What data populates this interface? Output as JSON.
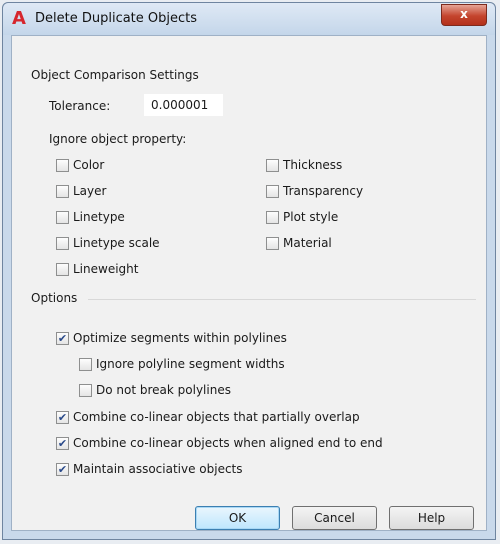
{
  "window": {
    "title": "Delete Duplicate Objects",
    "close_label": "x"
  },
  "comparison": {
    "group_label": "Object Comparison Settings",
    "tolerance_label": "Tolerance:",
    "tolerance_value": "0.000001",
    "ignore_label": "Ignore object property:",
    "properties": [
      {
        "label": "Color",
        "checked": false
      },
      {
        "label": "Layer",
        "checked": false
      },
      {
        "label": "Linetype",
        "checked": false
      },
      {
        "label": "Linetype scale",
        "checked": false
      },
      {
        "label": "Lineweight",
        "checked": false
      },
      {
        "label": "Thickness",
        "checked": false
      },
      {
        "label": "Transparency",
        "checked": false
      },
      {
        "label": "Plot style",
        "checked": false
      },
      {
        "label": "Material",
        "checked": false
      }
    ]
  },
  "options": {
    "group_label": "Options",
    "items": [
      {
        "label": "Optimize segments within polylines",
        "checked": true
      },
      {
        "label": "Ignore polyline segment widths",
        "checked": false
      },
      {
        "label": "Do not break polylines",
        "checked": false
      },
      {
        "label": "Combine co-linear objects that partially overlap",
        "checked": true
      },
      {
        "label": "Combine co-linear objects when aligned end to end",
        "checked": true
      },
      {
        "label": "Maintain associative objects",
        "checked": true
      }
    ]
  },
  "buttons": {
    "ok": "OK",
    "cancel": "Cancel",
    "help": "Help"
  }
}
